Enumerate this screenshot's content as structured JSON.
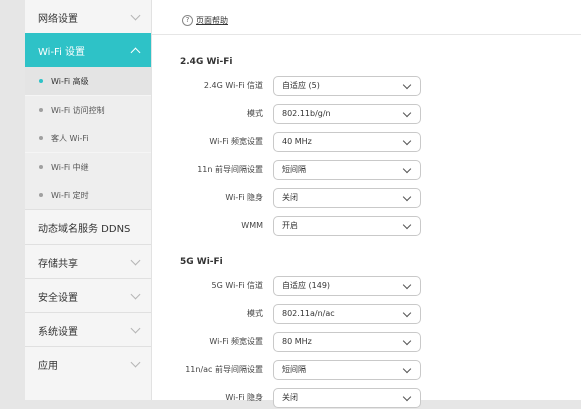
{
  "sidebar": {
    "items": [
      {
        "label": "网络设置"
      },
      {
        "label": "Wi-Fi 设置"
      },
      {
        "label": "动态域名服务 DDNS"
      },
      {
        "label": "存储共享"
      },
      {
        "label": "安全设置"
      },
      {
        "label": "系统设置"
      },
      {
        "label": "应用"
      }
    ],
    "subitems": [
      {
        "label": "Wi-Fi 高级"
      },
      {
        "label": "Wi-Fi 访问控制"
      },
      {
        "label": "客人 Wi-Fi"
      },
      {
        "label": "Wi-Fi 中继"
      },
      {
        "label": "Wi-Fi 定时"
      }
    ]
  },
  "main": {
    "help_icon": "?",
    "help_label": "页面帮助",
    "section_24": {
      "title": "2.4G Wi-Fi",
      "rows": [
        {
          "label": "2.4G Wi-Fi 信道",
          "value": "自适应 (5)"
        },
        {
          "label": "模式",
          "value": "802.11b/g/n"
        },
        {
          "label": "Wi-Fi 频宽设置",
          "value": "40 MHz"
        },
        {
          "label": "11n 前导间隔设置",
          "value": "短间隔"
        },
        {
          "label": "Wi-Fi 隐身",
          "value": "关闭"
        },
        {
          "label": "WMM",
          "value": "开启"
        }
      ]
    },
    "section_5": {
      "title": "5G Wi-Fi",
      "rows": [
        {
          "label": "5G Wi-Fi 信道",
          "value": "自适应 (149)"
        },
        {
          "label": "模式",
          "value": "802.11a/n/ac"
        },
        {
          "label": "Wi-Fi 频宽设置",
          "value": "80 MHz"
        },
        {
          "label": "11n/ac 前导间隔设置",
          "value": "短间隔"
        },
        {
          "label": "Wi-Fi 隐身",
          "value": "关闭"
        }
      ]
    }
  }
}
